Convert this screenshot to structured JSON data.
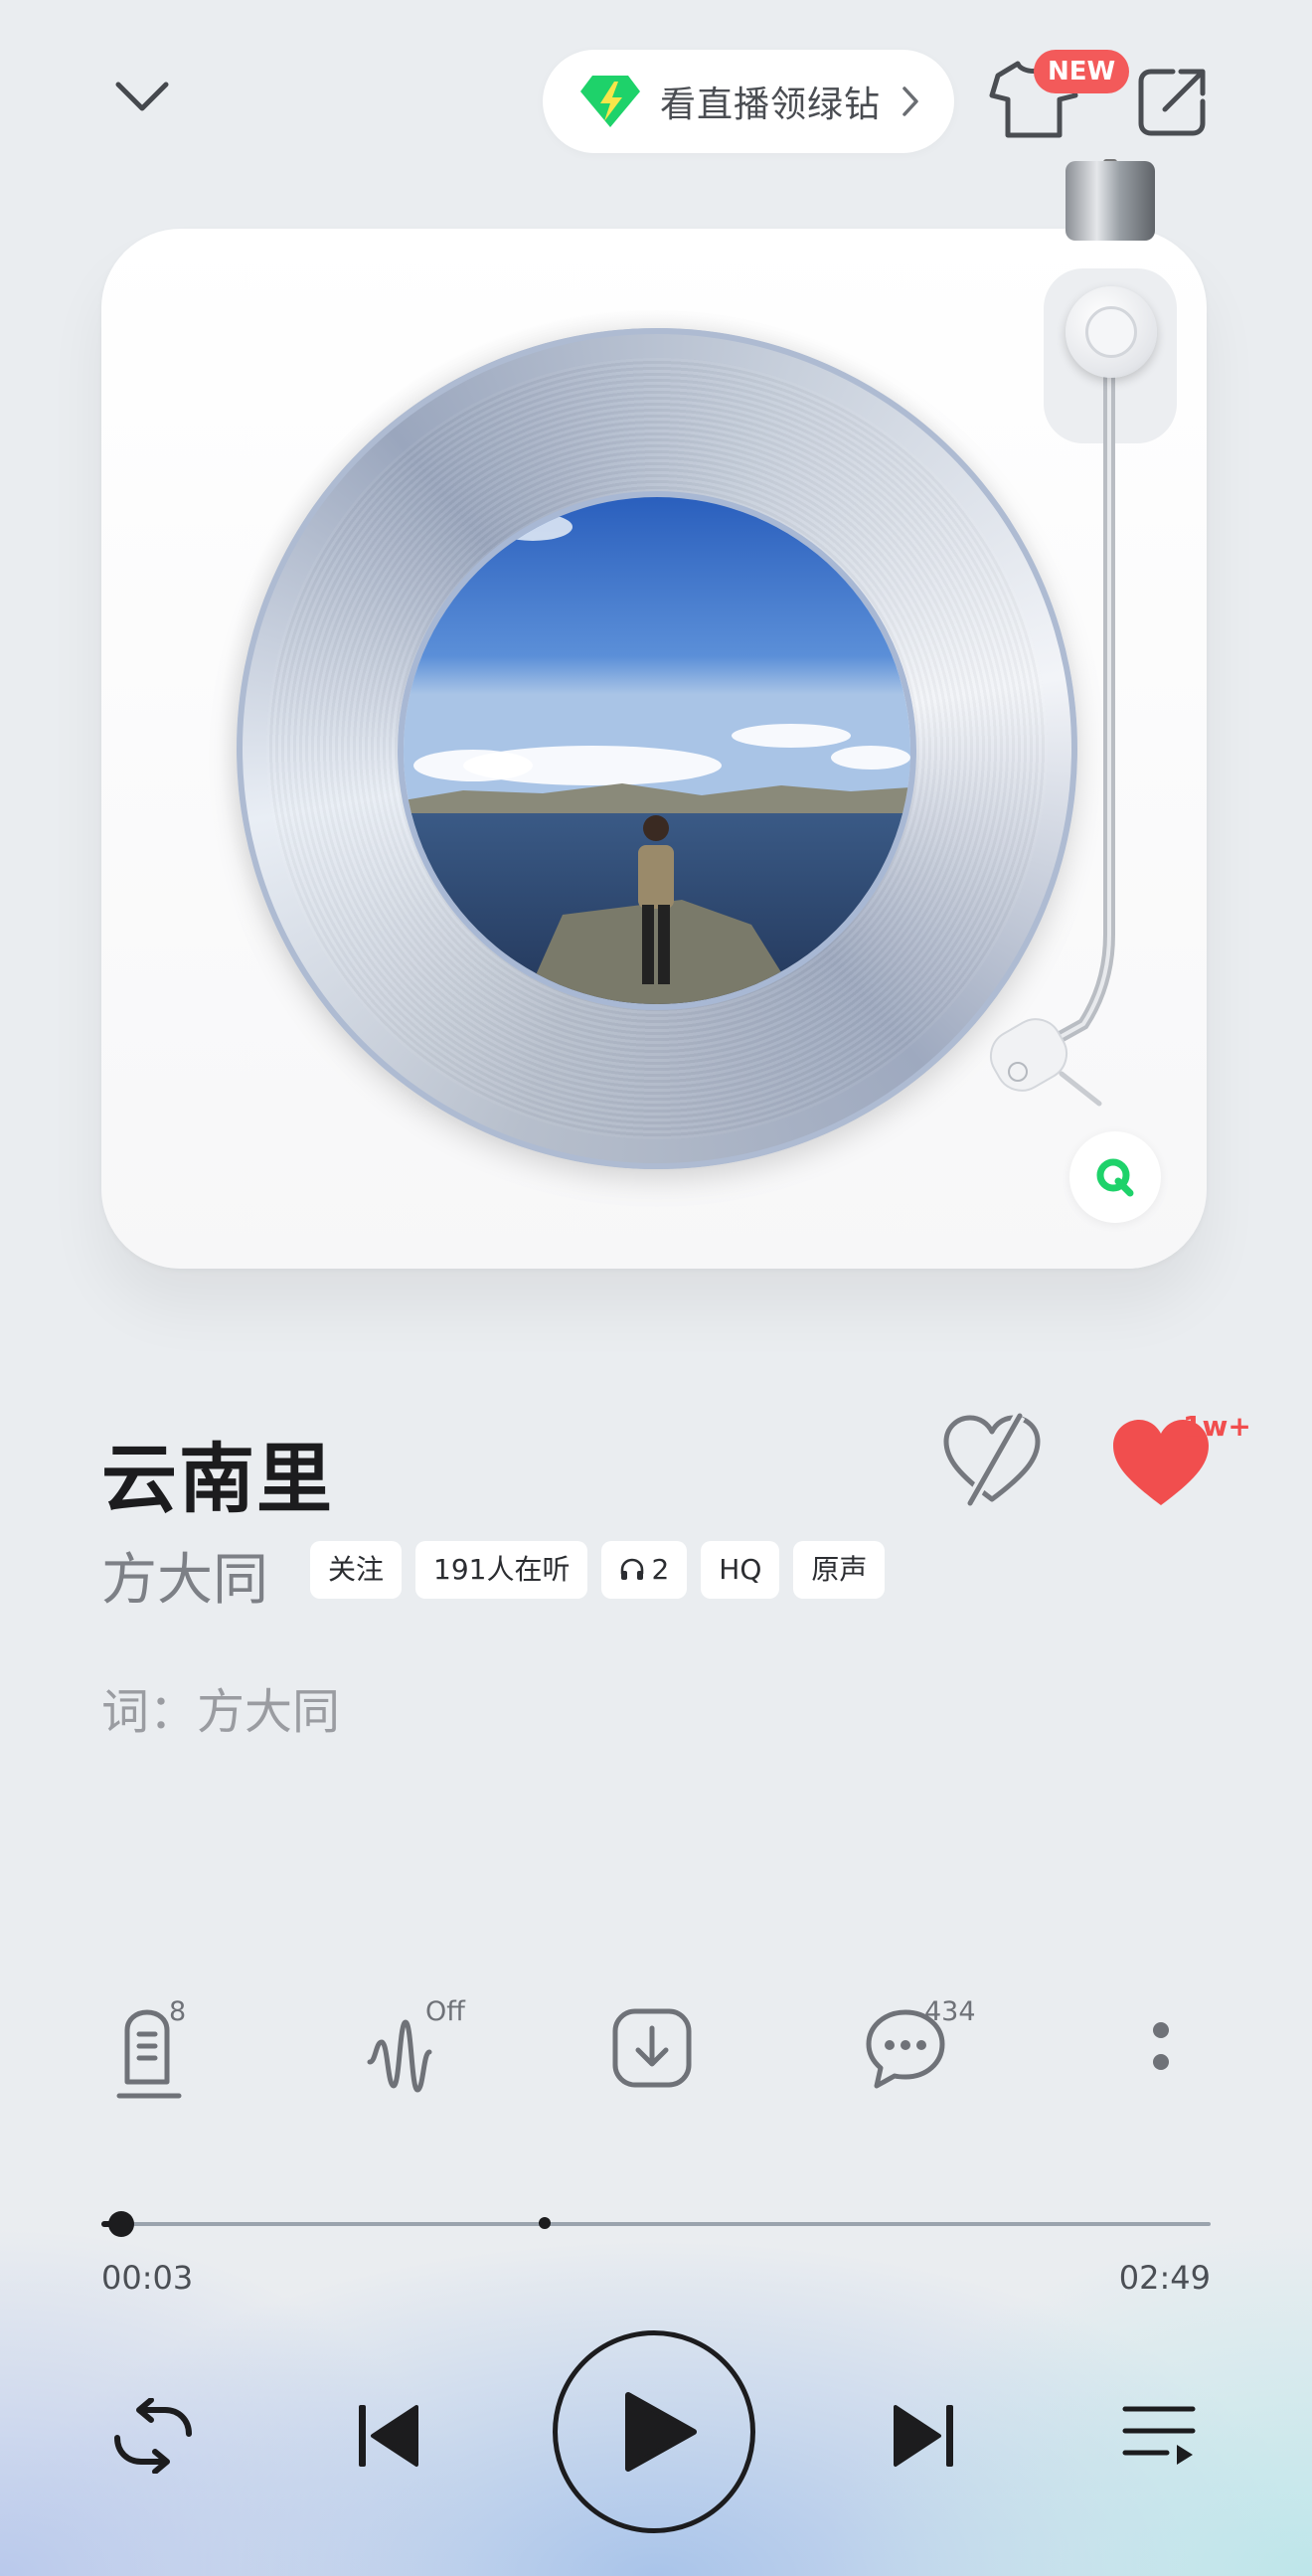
{
  "header": {
    "promo_label": "看直播领绿钻",
    "new_badge": "NEW"
  },
  "song": {
    "title": "云南里",
    "artist": "方大同",
    "tags": [
      "关注",
      "191人在听",
      "2",
      "HQ",
      "原声"
    ],
    "like_count": "1w+",
    "lyric_credit": "词：方大同"
  },
  "actions": {
    "lyrics_count": "8",
    "effect_state": "Off",
    "comments_count": "434"
  },
  "progress": {
    "current": "00:03",
    "total": "02:49",
    "played_fraction": 0.018,
    "buffered_fraction": 0.4
  },
  "colors": {
    "accent_green": "#1ed26a",
    "like_red": "#f14e4e",
    "badge_red": "#f35a5a"
  }
}
